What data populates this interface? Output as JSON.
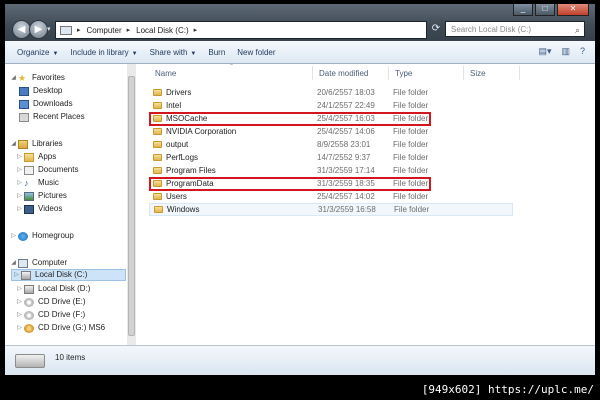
{
  "window": {
    "address": {
      "segments": [
        "Computer",
        "Local Disk (C:)"
      ]
    },
    "search_placeholder": "Search Local Disk (C:)"
  },
  "toolbar": {
    "organize": "Organize",
    "include_in_library": "Include in library",
    "share_with": "Share with",
    "burn": "Burn",
    "new_folder": "New folder"
  },
  "nav": {
    "favorites": {
      "label": "Favorites",
      "items": [
        "Desktop",
        "Downloads",
        "Recent Places"
      ]
    },
    "libraries": {
      "label": "Libraries",
      "items": [
        "Apps",
        "Documents",
        "Music",
        "Pictures",
        "Videos"
      ]
    },
    "homegroup": "Homegroup",
    "computer": {
      "label": "Computer",
      "items": [
        "Local Disk (C:)",
        "Local Disk (D:)",
        "CD Drive (E:)",
        "CD Drive (F:)",
        "CD Drive (G:) MS6"
      ],
      "selected": "Local Disk (C:)"
    }
  },
  "columns": {
    "name": "Name",
    "date": "Date modified",
    "type": "Type",
    "size": "Size"
  },
  "files": [
    {
      "name": "Drivers",
      "date": "20/6/2557 18:03",
      "type": "File folder"
    },
    {
      "name": "Intel",
      "date": "24/1/2557 22:49",
      "type": "File folder"
    },
    {
      "name": "MSOCache",
      "date": "25/4/2557 16:03",
      "type": "File folder"
    },
    {
      "name": "NVIDIA Corporation",
      "date": "25/4/2557 14:06",
      "type": "File folder"
    },
    {
      "name": "output",
      "date": "8/9/2558 23:01",
      "type": "File folder"
    },
    {
      "name": "PerfLogs",
      "date": "14/7/2552 9:37",
      "type": "File folder"
    },
    {
      "name": "Program Files",
      "date": "31/3/2559 17:14",
      "type": "File folder"
    },
    {
      "name": "ProgramData",
      "date": "31/3/2559 18:35",
      "type": "File folder"
    },
    {
      "name": "Users",
      "date": "25/4/2557 14:02",
      "type": "File folder"
    },
    {
      "name": "Windows",
      "date": "31/3/2559 16:58",
      "type": "File folder"
    }
  ],
  "highlighted_files": [
    "MSOCache",
    "ProgramData"
  ],
  "hover_file": "Windows",
  "status": {
    "count": "10 items"
  },
  "watermark": "[949x602] https://uplc.me/",
  "colors": {
    "highlight_border": "#d4161c",
    "selection": "#cde3f8"
  }
}
